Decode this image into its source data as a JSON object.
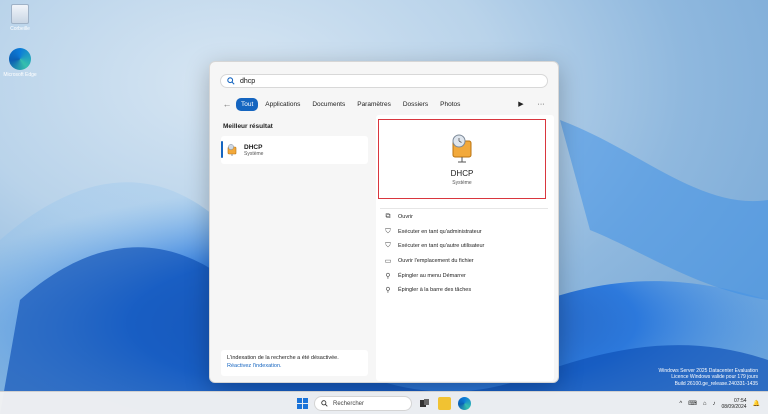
{
  "desktop": {
    "icons": [
      {
        "label": "Corbeille",
        "icon": "recycle-bin-icon"
      },
      {
        "label": "Microsoft Edge",
        "icon": "edge-icon"
      }
    ]
  },
  "search": {
    "query": "dhcp",
    "icon": "search-icon"
  },
  "tabs": {
    "back": "←",
    "items": [
      {
        "label": "Tout",
        "active": true
      },
      {
        "label": "Applications"
      },
      {
        "label": "Documents"
      },
      {
        "label": "Paramètres"
      },
      {
        "label": "Dossiers"
      },
      {
        "label": "Photos"
      }
    ],
    "play": "▶",
    "more": "···"
  },
  "results": {
    "best_label": "Meilleur résultat",
    "best": {
      "name": "DHCP",
      "type": "Système",
      "icon": "dhcp-server-icon"
    },
    "index_note": "L'indexation de la recherche a été désactivée.",
    "index_link": "Réactivez l'indexation."
  },
  "detail": {
    "name": "DHCP",
    "type": "Système",
    "actions": [
      {
        "label": "Ouvrir",
        "icon": "open-icon"
      },
      {
        "label": "Exécuter en tant qu'administrateur",
        "icon": "shield-icon"
      },
      {
        "label": "Exécuter en tant qu'autre utilisateur",
        "icon": "user-icon"
      },
      {
        "label": "Ouvrir l'emplacement du fichier",
        "icon": "folder-icon"
      },
      {
        "label": "Épingler au menu Démarrer",
        "icon": "pin-icon"
      },
      {
        "label": "Épingler à la barre des tâches",
        "icon": "pin-icon"
      }
    ]
  },
  "watermark": {
    "line1": "Windows Server 2025 Datacenter Evaluation",
    "line2": "Licence Windows valide pour 179 jours",
    "line3": "Build 26100.ge_release.240331-1435"
  },
  "taskbar": {
    "search_placeholder": "Rechercher",
    "time": "07:54",
    "date": "08/09/2024",
    "tray_chevron": "^",
    "colors": {
      "accent": "#1a73d9"
    }
  }
}
